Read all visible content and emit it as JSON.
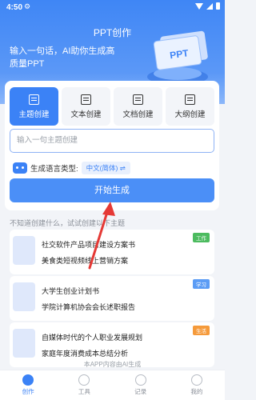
{
  "status_bar": {
    "time": "4:50",
    "settings_icon": "gear-icon"
  },
  "header": {
    "title": "PPT创作",
    "description": "输入一句话，AI助你生成高质量PPT",
    "art_label": "PPT"
  },
  "tabs": [
    {
      "label": "主题创建",
      "icon": "theme-icon",
      "active": true
    },
    {
      "label": "文本创建",
      "icon": "text-icon",
      "active": false
    },
    {
      "label": "文档创建",
      "icon": "document-icon",
      "active": false
    },
    {
      "label": "大纲创建",
      "icon": "outline-icon",
      "active": false
    }
  ],
  "topic_input": {
    "placeholder": "输入一句主题创建"
  },
  "language": {
    "label": "生成语言类型:",
    "value": "中文(简体)",
    "switch_icon": "⇌"
  },
  "start_button": {
    "label": "开始生成"
  },
  "hint": "不知道创建什么，试试创建以下主题",
  "suggestions": [
    {
      "line1": "社交软件产品项目建设方案书",
      "line2": "美食类短视频线上营销方案",
      "tag": "工作",
      "tag_color": "#4cbb5f"
    },
    {
      "line1": "大学生创业计划书",
      "line2": "学院计算机协会会长述职报告",
      "tag": "学习",
      "tag_color": "#5b9cf5"
    },
    {
      "line1": "自媒体时代的个人职业发展规划",
      "line2": "家庭年度消费成本总结分析",
      "tag": "生活",
      "tag_color": "#f59a3b"
    }
  ],
  "footer_note": "本APP内容由AI生成",
  "bottom_nav": [
    {
      "label": "创作",
      "active": true
    },
    {
      "label": "工具",
      "active": false
    },
    {
      "label": "记录",
      "active": false
    },
    {
      "label": "我的",
      "active": false
    }
  ],
  "colors": {
    "accent": "#3b82f6",
    "annotation": "#e53935"
  }
}
